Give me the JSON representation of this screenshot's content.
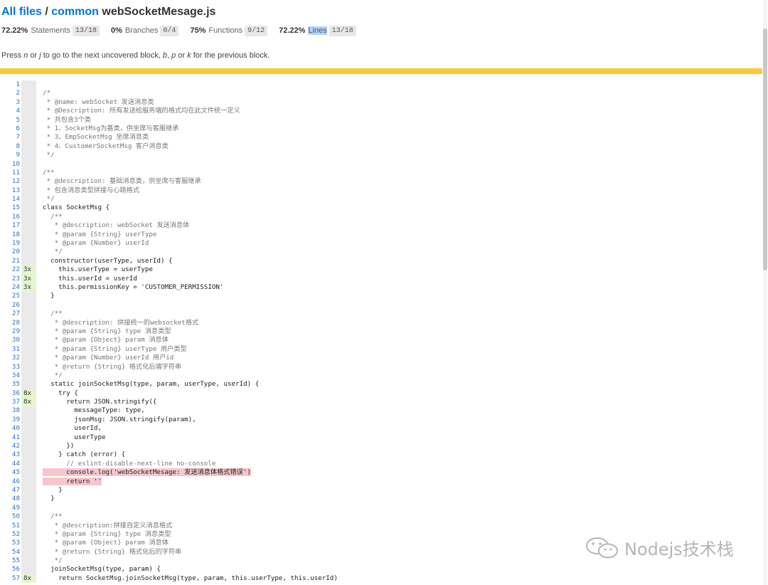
{
  "breadcrumb": {
    "all_files": "All files",
    "separator": " / ",
    "folder": "common",
    "file": "webSocketMesage.js"
  },
  "summary": [
    {
      "pct": "72.22%",
      "label": "Statements",
      "fraction": "13/18",
      "highlighted": false
    },
    {
      "pct": "0%",
      "label": "Branches",
      "fraction": "0/4",
      "highlighted": false
    },
    {
      "pct": "75%",
      "label": "Functions",
      "fraction": "9/12",
      "highlighted": false
    },
    {
      "pct": "72.22%",
      "label": "Lines",
      "fraction": "13/18",
      "highlighted": true
    }
  ],
  "help": {
    "p1": "Press ",
    "k1": "n",
    "p2": " or ",
    "k2": "j",
    "p3": " to go to the next uncovered block, ",
    "k3": "b",
    "p4": ", ",
    "k4": "p",
    "p5": " or ",
    "k5": "k",
    "p6": " for the previous block."
  },
  "colors": {
    "status_bar": "#f5cc37",
    "covered_hits": "#e6f5d0",
    "uncovered_line": "#f6c6ce",
    "link": "#0074d9"
  },
  "code_lines": [
    {
      "n": "1",
      "hits": "",
      "text": ""
    },
    {
      "n": "2",
      "hits": "",
      "text": "/*"
    },
    {
      "n": "3",
      "hits": "",
      "text": " * @name: webSocket 发送消息类"
    },
    {
      "n": "4",
      "hits": "",
      "text": " * @Description: 所有发送给服务端的格式均在此文件统一定义"
    },
    {
      "n": "5",
      "hits": "",
      "text": " * 共包含3个类"
    },
    {
      "n": "6",
      "hits": "",
      "text": " * 1、SocketMsg为基类，供坐席与客服继承"
    },
    {
      "n": "7",
      "hits": "",
      "text": " * 3、EmpSocketMsg 坐席消息类"
    },
    {
      "n": "8",
      "hits": "",
      "text": " * 4、CustomerSocketMsg 客户消息类"
    },
    {
      "n": "9",
      "hits": "",
      "text": " */"
    },
    {
      "n": "10",
      "hits": "",
      "text": ""
    },
    {
      "n": "11",
      "hits": "",
      "text": "/**"
    },
    {
      "n": "12",
      "hits": "",
      "text": " * @description: 基础消息类，供坐席与客服继承"
    },
    {
      "n": "13",
      "hits": "",
      "text": " * 包含消息类型拼接与心跳格式"
    },
    {
      "n": "14",
      "hits": "",
      "text": " */"
    },
    {
      "n": "15",
      "hits": "",
      "text": "class SocketMsg {"
    },
    {
      "n": "16",
      "hits": "",
      "text": "  /**"
    },
    {
      "n": "17",
      "hits": "",
      "text": "   * @description: webSocket 发送消息体"
    },
    {
      "n": "18",
      "hits": "",
      "text": "   * @param {String} userType"
    },
    {
      "n": "19",
      "hits": "",
      "text": "   * @param {Number} userId"
    },
    {
      "n": "20",
      "hits": "",
      "text": "   */"
    },
    {
      "n": "21",
      "hits": "",
      "text": "  constructor(userType, userId) {"
    },
    {
      "n": "22",
      "hits": "3x",
      "text": "    this.userType = userType"
    },
    {
      "n": "23",
      "hits": "3x",
      "text": "    this.userId = userId"
    },
    {
      "n": "24",
      "hits": "3x",
      "text": "    this.permissionKey = 'CUSTOMER_PERMISSION'"
    },
    {
      "n": "25",
      "hits": "",
      "text": "  }"
    },
    {
      "n": "26",
      "hits": "",
      "text": ""
    },
    {
      "n": "27",
      "hits": "",
      "text": "  /**"
    },
    {
      "n": "28",
      "hits": "",
      "text": "   * @description: 拼接统一的websocket格式"
    },
    {
      "n": "29",
      "hits": "",
      "text": "   * @param {String} type 消息类型"
    },
    {
      "n": "30",
      "hits": "",
      "text": "   * @param {Object} param 消息体"
    },
    {
      "n": "31",
      "hits": "",
      "text": "   * @param {String} userType 用户类型"
    },
    {
      "n": "32",
      "hits": "",
      "text": "   * @param {Number} userId 用户id"
    },
    {
      "n": "33",
      "hits": "",
      "text": "   * @return {String} 格式化后端字符串"
    },
    {
      "n": "34",
      "hits": "",
      "text": "   */"
    },
    {
      "n": "35",
      "hits": "",
      "text": "  static joinSocketMsg(type, param, userType, userId) {"
    },
    {
      "n": "36",
      "hits": "8x",
      "text": "    try {"
    },
    {
      "n": "37",
      "hits": "8x",
      "text": "      return JSON.stringify({"
    },
    {
      "n": "38",
      "hits": "",
      "text": "        messageType: type,"
    },
    {
      "n": "39",
      "hits": "",
      "text": "        jsonMsg: JSON.stringify(param),"
    },
    {
      "n": "40",
      "hits": "",
      "text": "        userId,"
    },
    {
      "n": "41",
      "hits": "",
      "text": "        userType"
    },
    {
      "n": "42",
      "hits": "",
      "text": "      })"
    },
    {
      "n": "43",
      "hits": "",
      "text": "    } catch (error) {"
    },
    {
      "n": "44",
      "hits": "",
      "text": "      // eslint-disable-next-line no-console"
    },
    {
      "n": "45",
      "hits": "",
      "text": "      console.log('webSocketMesage: 发送消息体格式错误')",
      "uncovered": true
    },
    {
      "n": "46",
      "hits": "",
      "text": "      return ''",
      "uncovered": true
    },
    {
      "n": "47",
      "hits": "",
      "text": "    }"
    },
    {
      "n": "48",
      "hits": "",
      "text": "  }"
    },
    {
      "n": "49",
      "hits": "",
      "text": ""
    },
    {
      "n": "50",
      "hits": "",
      "text": "  /**"
    },
    {
      "n": "51",
      "hits": "",
      "text": "   * @description:拼接自定义消息格式"
    },
    {
      "n": "52",
      "hits": "",
      "text": "   * @param {String} type 消息类型"
    },
    {
      "n": "53",
      "hits": "",
      "text": "   * @param {Object} param 消息体"
    },
    {
      "n": "54",
      "hits": "",
      "text": "   * @return {String} 格式化后的字符串"
    },
    {
      "n": "55",
      "hits": "",
      "text": "   */"
    },
    {
      "n": "56",
      "hits": "",
      "text": "  joinSocketMsg(type, param) {"
    },
    {
      "n": "57",
      "hits": "8x",
      "text": "    return SocketMsg.joinSocketMsg(type, param, this.userType, this.userId)"
    }
  ],
  "watermark": {
    "icon": "wechat-icon",
    "text": "Nodejs技术栈"
  }
}
